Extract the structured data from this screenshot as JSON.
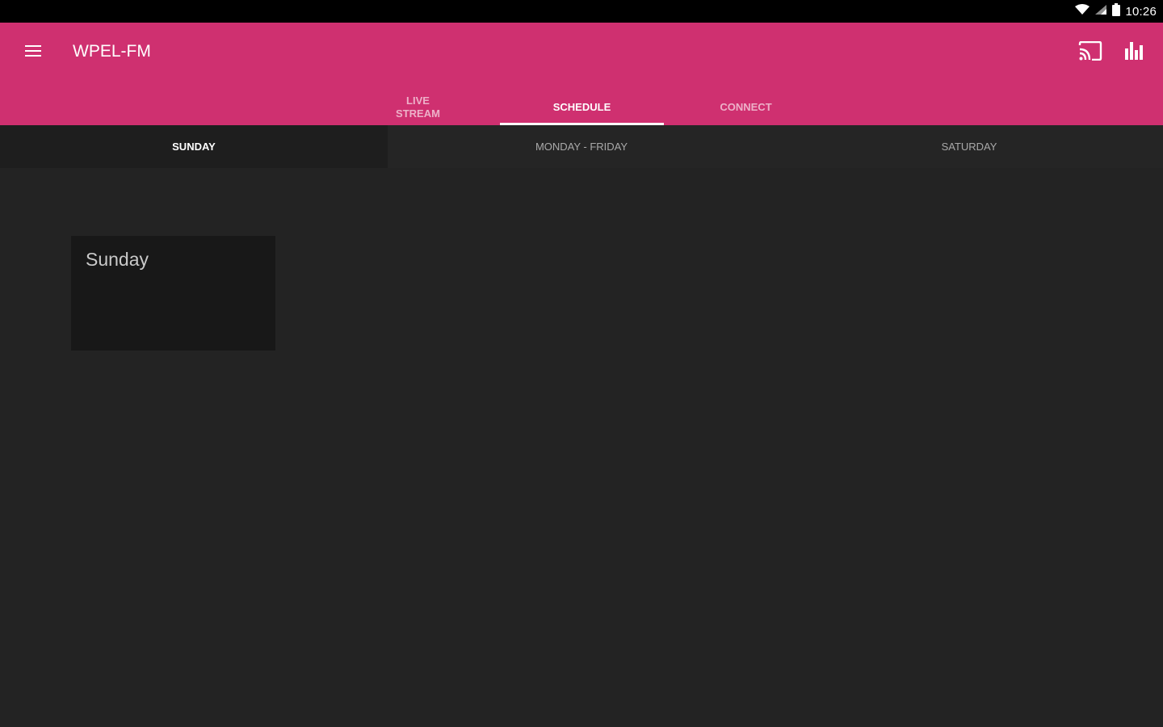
{
  "status_bar": {
    "time": "10:26"
  },
  "app_bar": {
    "title": "WPEL-FM",
    "color": "#cf3070",
    "menu_icon": "hamburger-menu-icon",
    "cast_icon": "cast-icon",
    "equalizer_icon": "equalizer-icon"
  },
  "main_tabs": [
    {
      "label": "LIVE\nSTREAM",
      "active": false
    },
    {
      "label": "SCHEDULE",
      "active": true
    },
    {
      "label": "CONNECT",
      "active": false
    }
  ],
  "day_tabs": [
    {
      "label": "SUNDAY",
      "active": true
    },
    {
      "label": "MONDAY - FRIDAY",
      "active": false
    },
    {
      "label": "SATURDAY",
      "active": false
    }
  ],
  "schedule": {
    "card_title": "Sunday"
  }
}
